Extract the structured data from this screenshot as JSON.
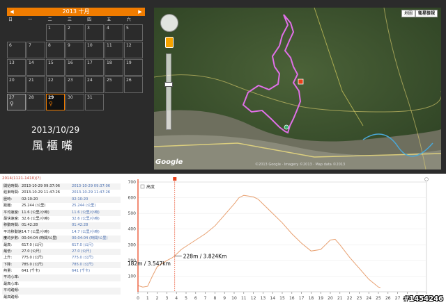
{
  "calendar": {
    "title": "2013 十月",
    "prev_label": "◀",
    "next_label": "▶",
    "weekdays": [
      "日",
      "一",
      "二",
      "三",
      "四",
      "五",
      "六"
    ],
    "leading_blanks": 2,
    "days": [
      "1",
      "2",
      "3",
      "4",
      "5",
      "6",
      "7",
      "8",
      "9",
      "10",
      "11",
      "12",
      "13",
      "14",
      "15",
      "16",
      "17",
      "18",
      "19",
      "20",
      "21",
      "22",
      "23",
      "24",
      "25",
      "26",
      "27",
      "28",
      "29",
      "30",
      "31"
    ],
    "ride_days": [
      "27",
      "29"
    ],
    "selected_day": "29"
  },
  "ride": {
    "date": "2013/10/29",
    "name": "風櫃嘴"
  },
  "map": {
    "btn_map": "地圖",
    "btn_satellite": "衛星檢視",
    "logo": "Google",
    "copyright": "©2013 Google · Imagery ©2013 · Map data ©2013"
  },
  "stats": {
    "title": "2014(1121-1410)(?)",
    "rows": [
      {
        "k": "開始時間:",
        "v1": "2013-10-29 09:37:06",
        "v2": "2013-10-29 09:37:06"
      },
      {
        "k": "結束時間:",
        "v1": "2013-10-29 11:47:26",
        "v2": "2013-10-29 11:47:26"
      },
      {
        "k": "歷時:",
        "v1": "02:10:20",
        "v2": "02:10:20"
      },
      {
        "k": "距離:",
        "v1": "25.244 (公里)",
        "v2": "25.244 (公里)"
      },
      {
        "k": "平均速度:",
        "v1": "11.6 (公里/小時)",
        "v2": "11.6 (公里/小時)"
      },
      {
        "k": "最快速度:",
        "v1": "32.6 (公里/小時)",
        "v2": "32.6 (公里/小時)"
      },
      {
        "k": "移動時間:",
        "v1": "01:42:28",
        "v2": "01:42:28"
      },
      {
        "k": "平均移動速度:",
        "v1": "14.7 (公里/小時)",
        "v2": "14.7 (公里/小時)"
      },
      {
        "k": "平均步數:",
        "v1": "00:04:04 (時間/公里)",
        "v2": "00:04:04 (時間/公里)"
      },
      {
        "k": "最高:",
        "v1": "617.0 (公尺)",
        "v2": "617.0 (公尺)"
      },
      {
        "k": "最低:",
        "v1": "27.0 (公尺)",
        "v2": "27.0 (公尺)"
      },
      {
        "k": "上升:",
        "v1": "775.0 (公尺)",
        "v2": "775.0 (公尺)"
      },
      {
        "k": "下降:",
        "v1": "785.0 (公尺)",
        "v2": "785.0 (公尺)"
      },
      {
        "k": "熱量:",
        "v1": "641 (千卡)",
        "v2": "641 (千卡)"
      },
      {
        "k": "平均心率:",
        "v1": "",
        "v2": ""
      },
      {
        "k": "最高心率:",
        "v1": "",
        "v2": ""
      },
      {
        "k": "平均踏頻:",
        "v1": "",
        "v2": ""
      },
      {
        "k": "最高踏頻:",
        "v1": "",
        "v2": ""
      }
    ]
  },
  "watermark": "#1454246",
  "colors": {
    "accent": "#f07c00",
    "track": "#e070e8",
    "elevation_line": "#e8a070",
    "marker": "#e8401a"
  },
  "chart_data": {
    "type": "line",
    "legend": "高度",
    "xlim": [
      0,
      30
    ],
    "ylim": [
      0,
      700
    ],
    "xticks": [
      0,
      1,
      2,
      3,
      4,
      5,
      6,
      7,
      8,
      9,
      10,
      11,
      12,
      13,
      14,
      15,
      16,
      17,
      18,
      19,
      20,
      21,
      22,
      23,
      24,
      25,
      26,
      27,
      28,
      29,
      30
    ],
    "yticks": [
      100,
      200,
      300,
      400,
      500,
      600,
      700
    ],
    "x": [
      0,
      0.5,
      1,
      1.5,
      2,
      2.5,
      3,
      3.5,
      3.8,
      4.5,
      5,
      6,
      7,
      8,
      9,
      10,
      10.5,
      11,
      11.5,
      12,
      12.5,
      13,
      14,
      15,
      16,
      17,
      18,
      19,
      19.5,
      20,
      20.5,
      21,
      22,
      23,
      24,
      25,
      25.2
    ],
    "y": [
      40,
      30,
      35,
      100,
      160,
      180,
      200,
      215,
      228,
      270,
      290,
      330,
      370,
      420,
      490,
      560,
      600,
      615,
      610,
      605,
      590,
      560,
      500,
      440,
      370,
      310,
      260,
      270,
      300,
      330,
      335,
      300,
      220,
      150,
      80,
      30,
      27
    ],
    "annotations": [
      {
        "label": "182m / 3.547km",
        "x": 3.547,
        "y": 182
      },
      {
        "label": "228m / 3.824Km",
        "x": 3.824,
        "y": 228
      }
    ],
    "cursor_x": 3.824
  }
}
